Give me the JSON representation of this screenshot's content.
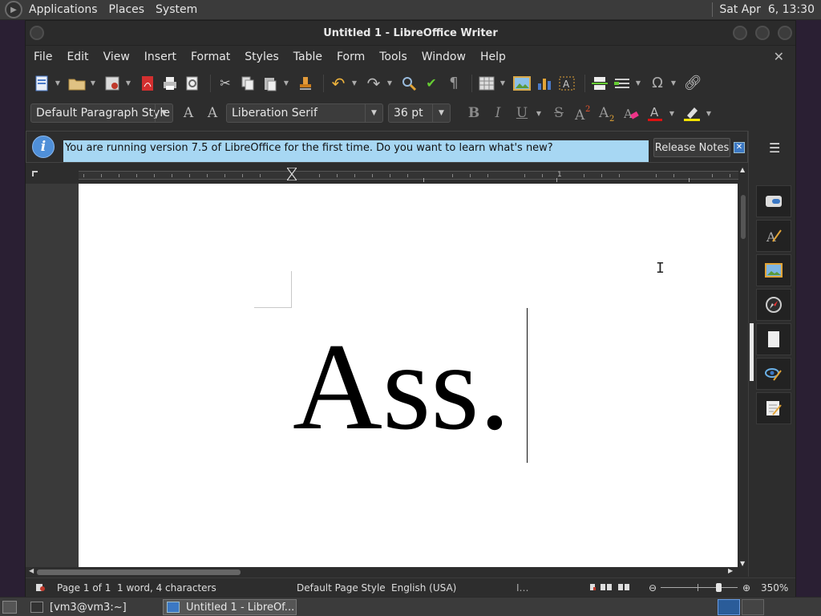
{
  "top_panel": {
    "menus": [
      "Applications",
      "Places",
      "System"
    ],
    "clock": "Sat Apr  6, 13:30"
  },
  "window": {
    "title": "Untitled 1 - LibreOffice Writer"
  },
  "menubar": [
    "File",
    "Edit",
    "View",
    "Insert",
    "Format",
    "Styles",
    "Table",
    "Form",
    "Tools",
    "Window",
    "Help"
  ],
  "formatting": {
    "paragraph_style": "Default Paragraph Style",
    "font_name": "Liberation Serif",
    "font_size": "36 pt",
    "bold_glyph": "B",
    "italic_glyph": "I",
    "underline_glyph": "U",
    "strike_glyph": "S"
  },
  "infobar": {
    "icon_glyph": "i",
    "message": "You are running version 7.5 of LibreOffice for the first time. Do you want to learn what's new?",
    "release_notes_label": "Release Notes",
    "close_glyph": "✕"
  },
  "ruler": {
    "marker_label": "1"
  },
  "document": {
    "text": "Ass."
  },
  "statusbar": {
    "page": "Page 1 of 1",
    "word_count": "1 word, 4 characters",
    "page_style": "Default Page Style",
    "language": "English (USA)",
    "zoom": "350%"
  },
  "taskbar": {
    "tasks": [
      "[vm3@vm3:~]",
      "Untitled 1 - LibreOf..."
    ]
  },
  "colors": {
    "accent": "#4f8fd8",
    "infobar_bg": "#a7d7f3",
    "window_bg": "#2d2d2d"
  },
  "icons": {
    "sidebar": [
      "properties-icon",
      "styles-icon",
      "gallery-icon",
      "navigator-icon",
      "page-icon",
      "style-inspector-icon",
      "manage-changes-icon"
    ]
  }
}
